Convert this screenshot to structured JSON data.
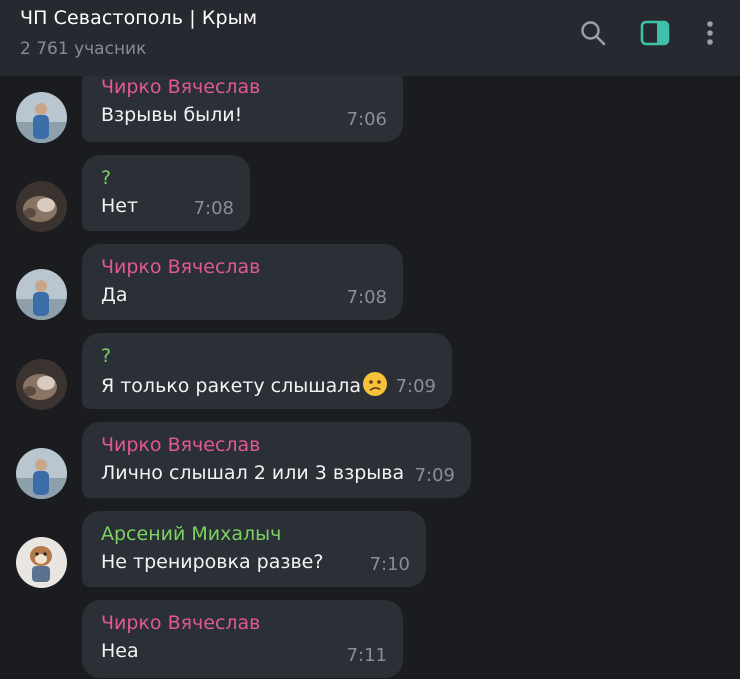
{
  "header": {
    "title": "ЧП Севастополь | Крым",
    "subtitle": "2 761 учасник",
    "icons": [
      "search-icon",
      "sidebar-toggle-icon",
      "more-vertical-icon"
    ],
    "accent": "#3ec1a8"
  },
  "colors": {
    "background": "#1b1c1f",
    "bubble": "#2b2f36",
    "sender_pink": "#e2598f",
    "sender_green": "#7cd163"
  },
  "messages": [
    {
      "sender": "Чирко Вячеслав",
      "text": "Взрывы были!",
      "time": "7:06"
    },
    {
      "sender": "?",
      "text": "Нет",
      "time": "7:08"
    },
    {
      "sender": "Чирко Вячеслав",
      "text": "Да",
      "time": "7:08"
    },
    {
      "sender": "?",
      "text": "Я только ракету слышала",
      "emoji": "confused-face-emoji",
      "time": "7:09"
    },
    {
      "sender": "Чирко Вячеслав",
      "text": "Лично слышал 2 или 3 взрыва",
      "time": "7:09"
    },
    {
      "sender": "Арсений Михалыч",
      "text": "Не тренировка разве?",
      "time": "7:10"
    },
    {
      "sender": "Чирко Вячеслав",
      "text": "Неа",
      "time": "7:11"
    }
  ]
}
